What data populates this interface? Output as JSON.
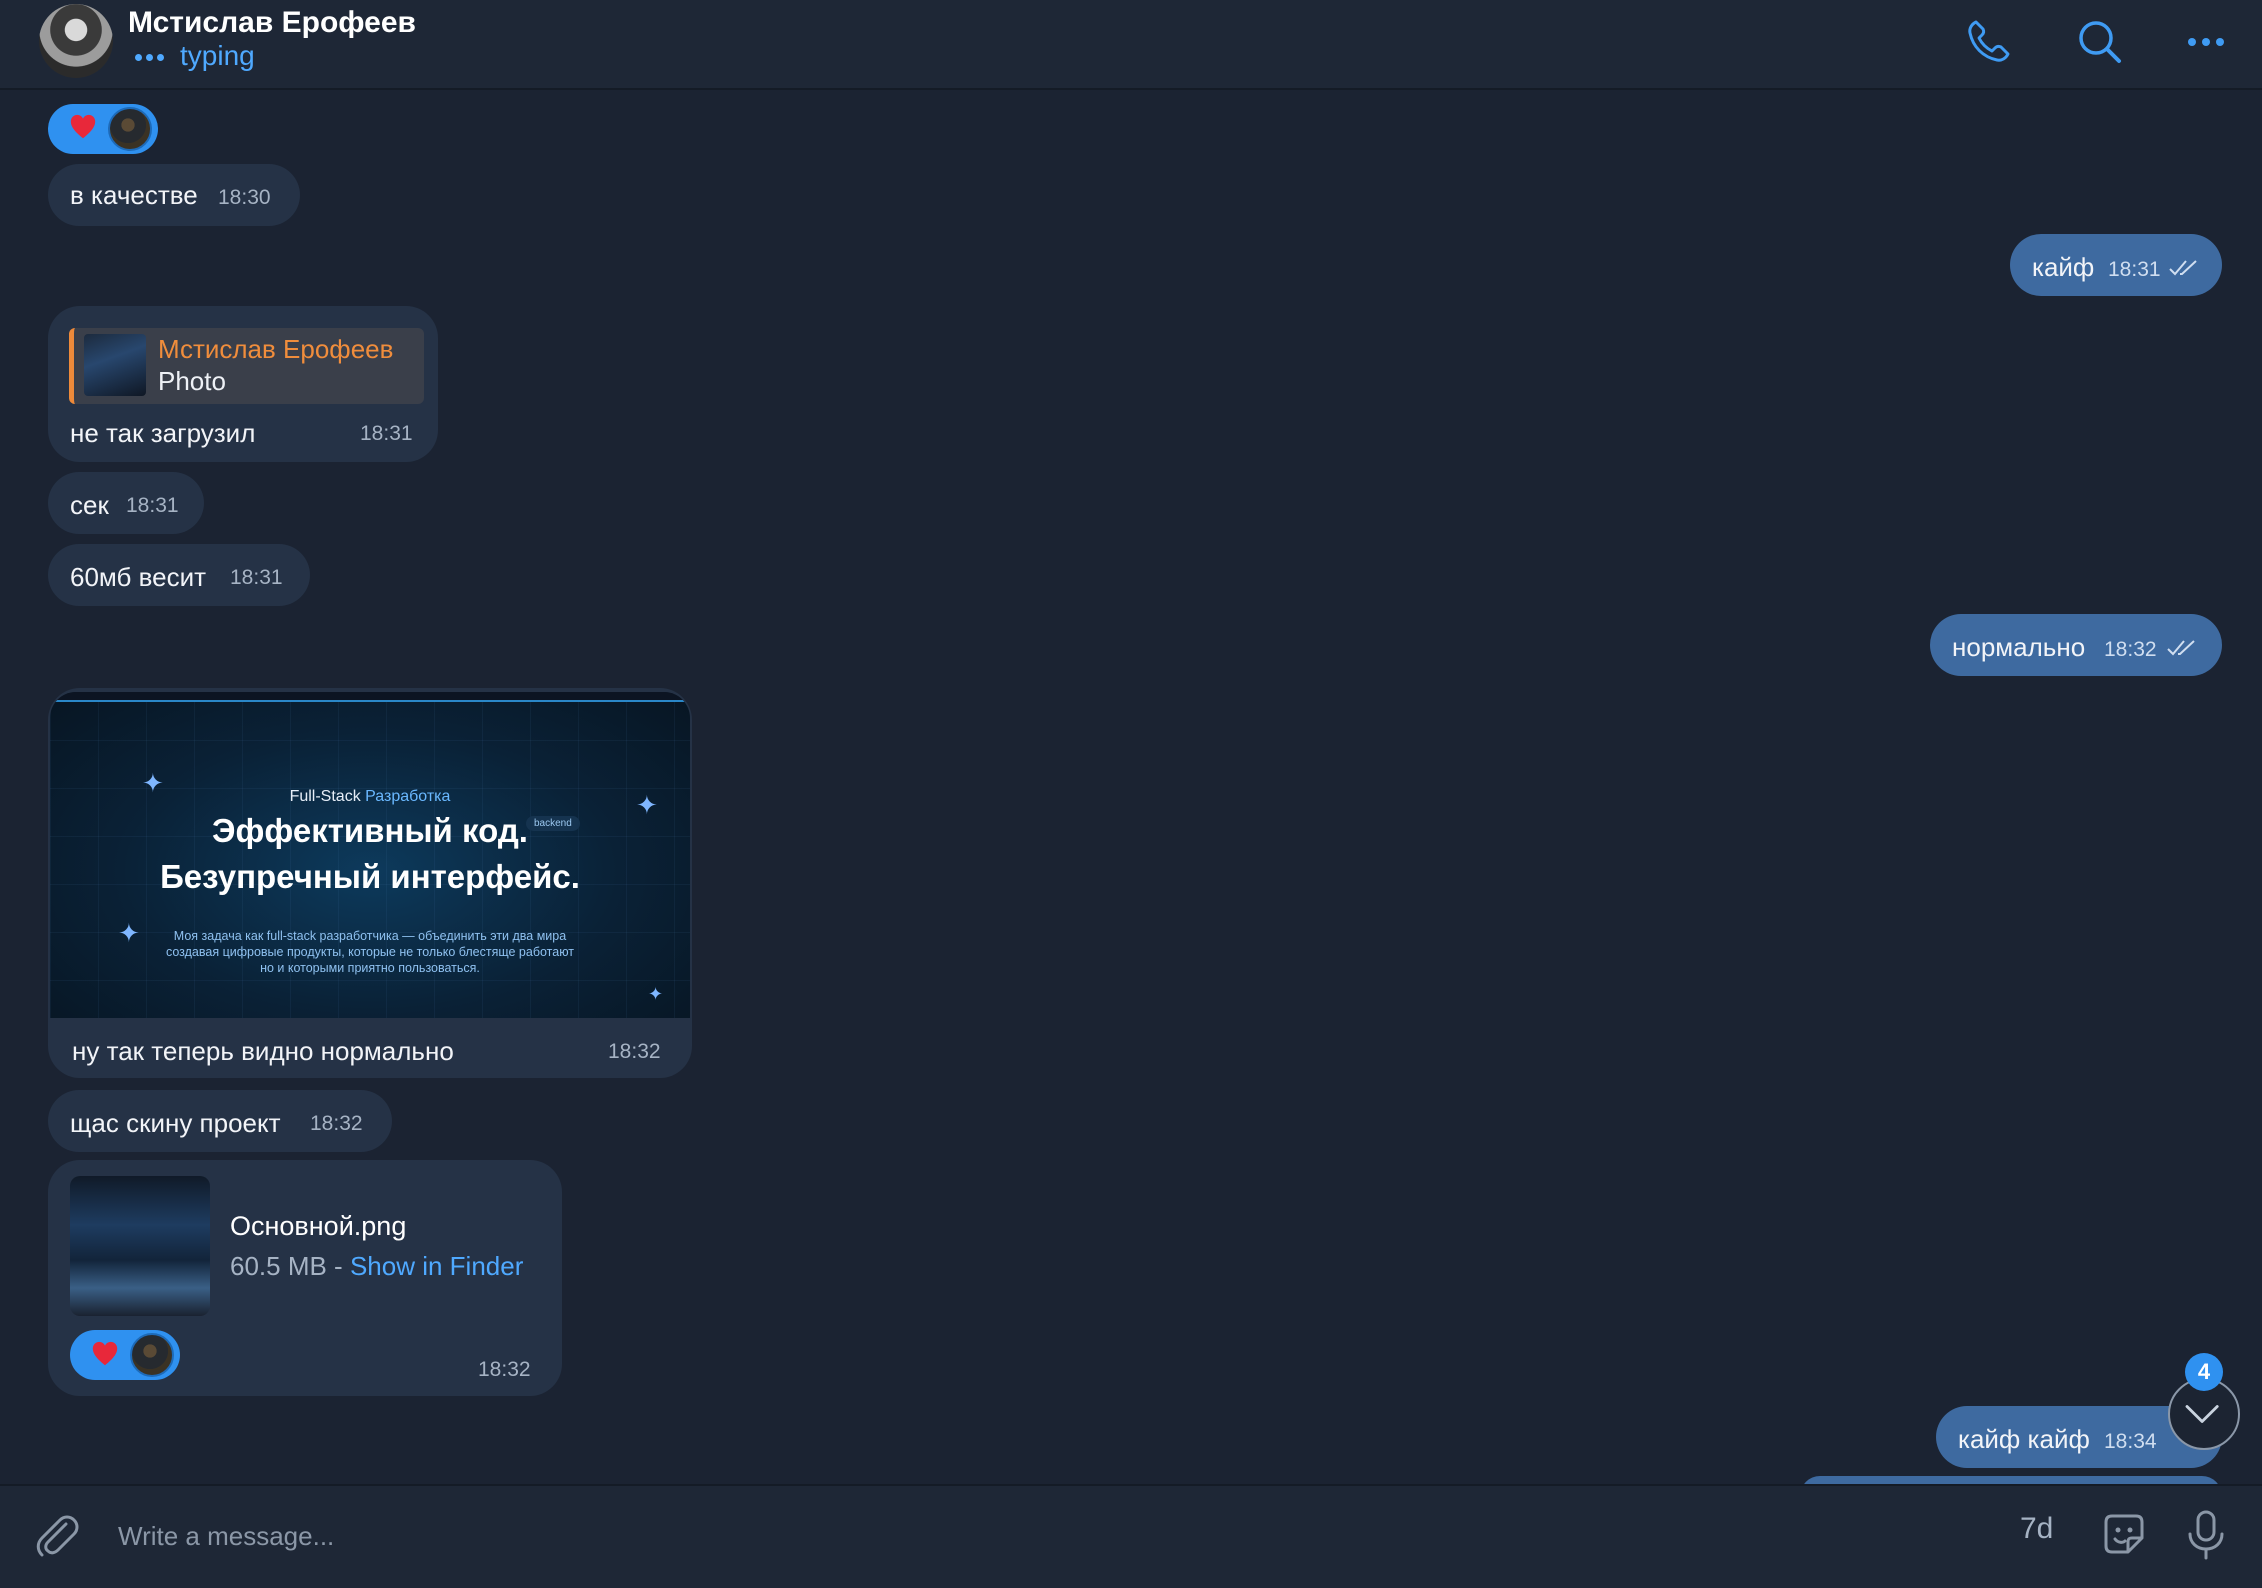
{
  "header": {
    "contact_name": "Мстислав Ерофеев",
    "status": "typing",
    "icons": [
      "phone-icon",
      "search-icon",
      "more-icon"
    ]
  },
  "messages": [
    {
      "id": "m1",
      "direction": "in",
      "text": "в качестве",
      "time": "18:30"
    },
    {
      "id": "m2",
      "direction": "out",
      "text": "кайф",
      "time": "18:31",
      "read": true
    },
    {
      "id": "m3",
      "direction": "in",
      "reply_to": {
        "author": "Мстислав Ерофеев",
        "snippet": "Photo"
      },
      "text": "не так загрузил",
      "time": "18:31"
    },
    {
      "id": "m4",
      "direction": "in",
      "text": "сек",
      "time": "18:31"
    },
    {
      "id": "m5",
      "direction": "in",
      "text": "60мб весит",
      "time": "18:31"
    },
    {
      "id": "m6",
      "direction": "out",
      "text": "нормально",
      "time": "18:32",
      "read": true
    },
    {
      "id": "m7",
      "direction": "in",
      "photo": {
        "kicker_prefix": "Full-Stack",
        "kicker_accent": "Разработка",
        "headline_1": "Эффективный код.",
        "badge": "backend",
        "headline_2": "Безупречный интерфейс.",
        "body": "Моя задача как full-stack разработчика — объединить эти два мира создавая цифровые продукты, которые не только блестяще работают но и которыми приятно пользоваться."
      },
      "text": "ну так теперь видно нормально",
      "time": "18:32"
    },
    {
      "id": "m8",
      "direction": "in",
      "text": "щас скину проект",
      "time": "18:32"
    },
    {
      "id": "m9",
      "direction": "in",
      "file": {
        "name": "Основной.png",
        "size": "60.5 MB",
        "separator": " - ",
        "action": "Show in Finder"
      },
      "time": "18:32"
    },
    {
      "id": "m10",
      "direction": "out",
      "text": "кайф кайф",
      "time": "18:34",
      "read": true
    }
  ],
  "scroll_button": {
    "unread_count": "4"
  },
  "composer": {
    "placeholder": "Write a message...",
    "timer": "7d"
  },
  "colors": {
    "background": "#1b2332",
    "incoming_bubble": "#253246",
    "outgoing_bubble": "#3e6aa0",
    "accent": "#4fa9ff",
    "reply_author": "#f08d3c"
  }
}
